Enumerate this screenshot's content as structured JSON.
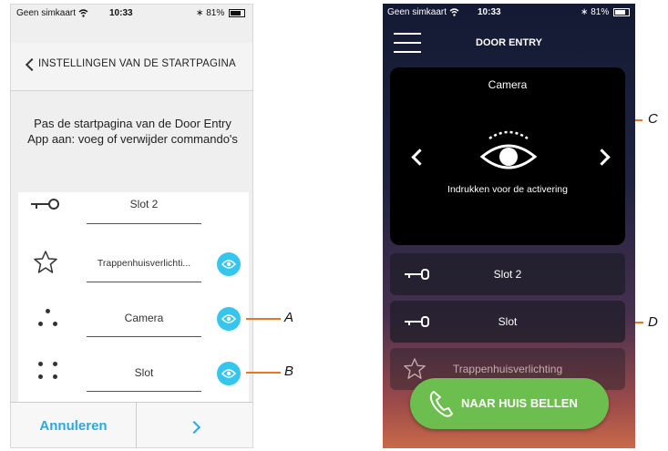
{
  "left_phone": {
    "status": {
      "carrier": "Geen simkaart",
      "time": "10:33",
      "battery": "81%"
    },
    "header_title": "INSTELLINGEN VAN DE STARTPAGINA",
    "description": "Pas de startpagina van de Door Entry App aan: voeg of verwijder commando's",
    "rows": [
      {
        "label": "Slot 2",
        "icon": "key-icon"
      },
      {
        "label": "Trappenhuisverlichti...",
        "icon": "star-icon",
        "eye": true
      },
      {
        "label": "Camera",
        "icon": "drag-dots-icon",
        "eye": true
      },
      {
        "label": "Slot",
        "icon": "drag-dots-icon",
        "eye": true
      }
    ],
    "footer": {
      "cancel": "Annuleren",
      "next_icon": "chevron-right-icon"
    }
  },
  "callouts": {
    "a": "A",
    "b": "B",
    "c": "C",
    "d": "D"
  },
  "right_phone": {
    "status": {
      "carrier": "Geen simkaart",
      "time": "10:33",
      "battery": "81%"
    },
    "title": "DOOR ENTRY",
    "camera": {
      "title": "Camera",
      "caption": "Indrukken voor de activering"
    },
    "rows": [
      {
        "label": "Slot 2",
        "icon": "key-icon"
      },
      {
        "label": "Slot",
        "icon": "key-icon"
      },
      {
        "label": "Trappenhuisverlichting",
        "icon": "star-icon"
      }
    ],
    "call_button": "NAAR HUIS BELLEN"
  },
  "colors": {
    "accent_blue": "#36c5ec",
    "callout_orange": "#e87722",
    "call_green": "#6cbf4e"
  }
}
